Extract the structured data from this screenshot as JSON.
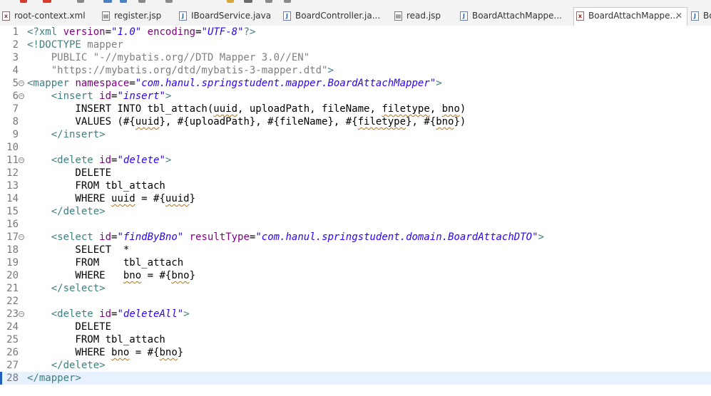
{
  "tabs": [
    {
      "label": "root-context.xml",
      "icon": "xml-file-icon",
      "active": false
    },
    {
      "label": "register.jsp",
      "icon": "jsp-file-icon",
      "active": false
    },
    {
      "label": "IBoardService.java",
      "icon": "java-file-icon",
      "active": false
    },
    {
      "label": "BoardController.ja...",
      "icon": "java-file-icon",
      "active": false
    },
    {
      "label": "read.jsp",
      "icon": "jsp-file-icon",
      "active": false
    },
    {
      "label": "BoardAttachMappe...",
      "icon": "java-file-icon",
      "active": false
    },
    {
      "label": "BoardAttachMappe...",
      "icon": "xml-file-icon",
      "active": true
    },
    {
      "label": "Bo",
      "icon": "java-file-icon",
      "active": false
    }
  ],
  "tab_close_glyph": "✕",
  "editor": {
    "current_line": 28,
    "lines": [
      {
        "n": "1",
        "tokens": [
          "<?xml version=\"1.0\" encoding=\"UTF-8\"?>"
        ]
      },
      {
        "n": "2",
        "tokens": [
          "<!DOCTYPE mapper"
        ]
      },
      {
        "n": "3",
        "tokens": [
          "    PUBLIC \"-//mybatis.org//DTD Mapper 3.0//EN\""
        ]
      },
      {
        "n": "4",
        "tokens": [
          "    \"https://mybatis.org/dtd/mybatis-3-mapper.dtd\">"
        ]
      },
      {
        "n": "5",
        "fold": true,
        "tokens": [
          "<mapper namespace=\"com.hanul.springstudent.mapper.BoardAttachMapper\">"
        ]
      },
      {
        "n": "6",
        "fold": true,
        "tokens": [
          "    <insert id=\"insert\">"
        ]
      },
      {
        "n": "7",
        "tokens": [
          "        INSERT INTO tbl_attach(uuid, uploadPath, fileName, filetype, bno)"
        ]
      },
      {
        "n": "8",
        "tokens": [
          "        VALUES (#{uuid}, #{uploadPath}, #{fileName}, #{filetype}, #{bno})"
        ]
      },
      {
        "n": "9",
        "tokens": [
          "    </insert>"
        ]
      },
      {
        "n": "10",
        "tokens": [
          ""
        ]
      },
      {
        "n": "11",
        "fold": true,
        "tokens": [
          "    <delete id=\"delete\">"
        ]
      },
      {
        "n": "12",
        "tokens": [
          "        DELETE"
        ]
      },
      {
        "n": "13",
        "tokens": [
          "        FROM tbl_attach"
        ]
      },
      {
        "n": "14",
        "tokens": [
          "        WHERE uuid = #{uuid}"
        ]
      },
      {
        "n": "15",
        "tokens": [
          "    </delete>"
        ]
      },
      {
        "n": "16",
        "tokens": [
          ""
        ]
      },
      {
        "n": "17",
        "fold": true,
        "tokens": [
          "    <select id=\"findByBno\" resultType=\"com.hanul.springstudent.domain.BoardAttachDTO\">"
        ]
      },
      {
        "n": "18",
        "tokens": [
          "        SELECT  *"
        ]
      },
      {
        "n": "19",
        "tokens": [
          "        FROM    tbl_attach"
        ]
      },
      {
        "n": "20",
        "tokens": [
          "        WHERE   bno = #{bno}"
        ]
      },
      {
        "n": "21",
        "tokens": [
          "    </select>"
        ]
      },
      {
        "n": "22",
        "tokens": [
          ""
        ]
      },
      {
        "n": "23",
        "fold": true,
        "tokens": [
          "    <delete id=\"deleteAll\">"
        ]
      },
      {
        "n": "24",
        "tokens": [
          "        DELETE"
        ]
      },
      {
        "n": "25",
        "tokens": [
          "        FROM tbl_attach"
        ]
      },
      {
        "n": "26",
        "tokens": [
          "        WHERE bno = #{bno}"
        ]
      },
      {
        "n": "27",
        "tokens": [
          "    </delete>"
        ]
      },
      {
        "n": "28",
        "tokens": [
          "</mapper>"
        ]
      }
    ]
  },
  "colors": {
    "tag": "#3f7f7f",
    "attribute": "#7f007f",
    "attribute_value": "#2a00ff",
    "doctype": "#808080",
    "current_line": "#e8f2fe"
  }
}
